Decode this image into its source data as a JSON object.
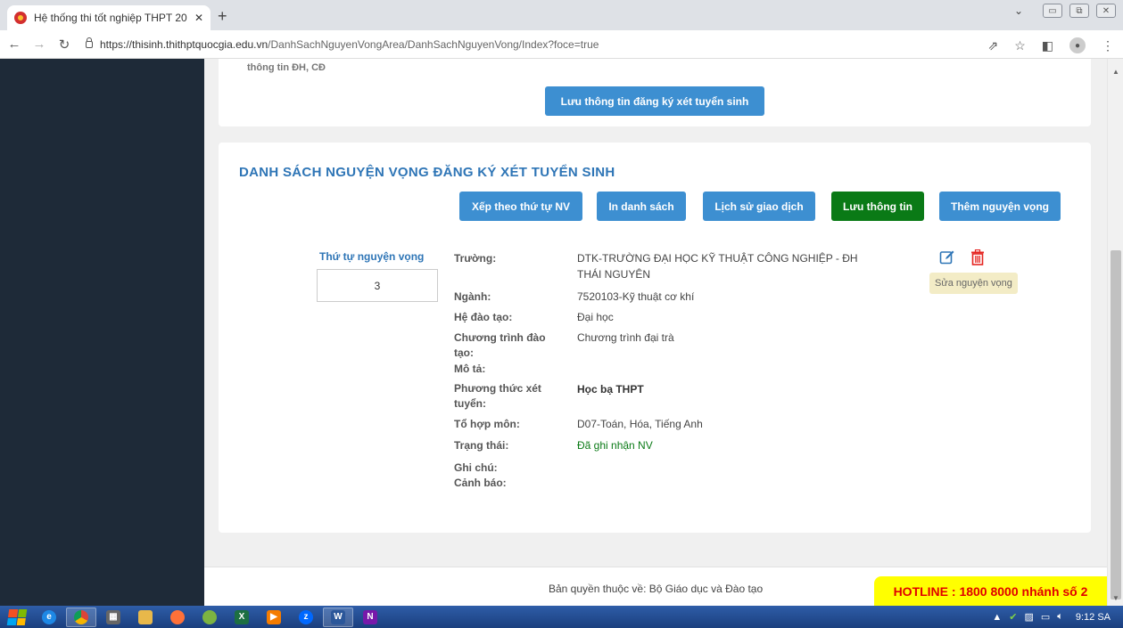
{
  "browser": {
    "tab_title": "Hệ thống thi tốt nghiệp THPT 20",
    "tab_close": "✕",
    "new_tab": "+",
    "url_host": "https://thisinh.thithptquocgia.edu.vn",
    "url_path": "/DanhSachNguyenVongArea/DanhSachNguyenVong/Index?foce=true"
  },
  "top_panel": {
    "cut_text": "thông tin ĐH, CĐ",
    "save_registration_label": "Lưu thông tin đăng ký xét tuyển sinh"
  },
  "list_panel": {
    "heading": "DANH SÁCH NGUYỆN VỌNG ĐĂNG KÝ XÉT TUYỂN SINH",
    "buttons": {
      "sort": "Xếp theo thứ tự NV",
      "print": "In danh sách",
      "history": "Lịch sử giao dịch",
      "save": "Lưu thông tin",
      "add": "Thêm nguyện vọng"
    },
    "order_label": "Thứ tự nguyện vọng",
    "order_value": "3",
    "fields": {
      "school_label": "Trường:",
      "school_value": "DTK-TRƯỜNG ĐẠI HỌC KỸ THUẬT CÔNG NGHIỆP - ĐH THÁI NGUYÊN",
      "major_label": "Ngành:",
      "major_value": "7520103-Kỹ thuật cơ khí",
      "system_label": "Hệ đào tạo:",
      "system_value": "Đại học",
      "program_label": "Chương trình đào tạo:",
      "program_value": "Chương trình đại trà",
      "desc_label": "Mô tả:",
      "method_label": "Phương thức xét tuyển:",
      "method_value": "Học bạ THPT",
      "combo_label": "Tổ hợp môn:",
      "combo_value": "D07-Toán, Hóa, Tiếng Anh",
      "status_label": "Trạng thái:",
      "status_value": "Đã ghi nhận NV",
      "note_label": "Ghi chú:",
      "warning_label": "Cảnh báo:"
    },
    "tooltip": "Sửa nguyện vọng"
  },
  "footer": {
    "copyright": "Bản quyền thuộc về: Bộ Giáo dục và Đào tạo",
    "hotline": "HOTLINE : 1800 8000 nhánh số 2"
  },
  "taskbar": {
    "time": "9:12 SA"
  },
  "colors": {
    "accent_blue": "#3d8fd1",
    "heading_blue": "#2e75b6",
    "save_green": "#0a7a16",
    "sidebar": "#1e2a38",
    "hotline_bg": "#ffff00",
    "hotline_text": "#e00000"
  },
  "icons": {
    "edit": "edit-icon",
    "delete": "trash-icon"
  }
}
